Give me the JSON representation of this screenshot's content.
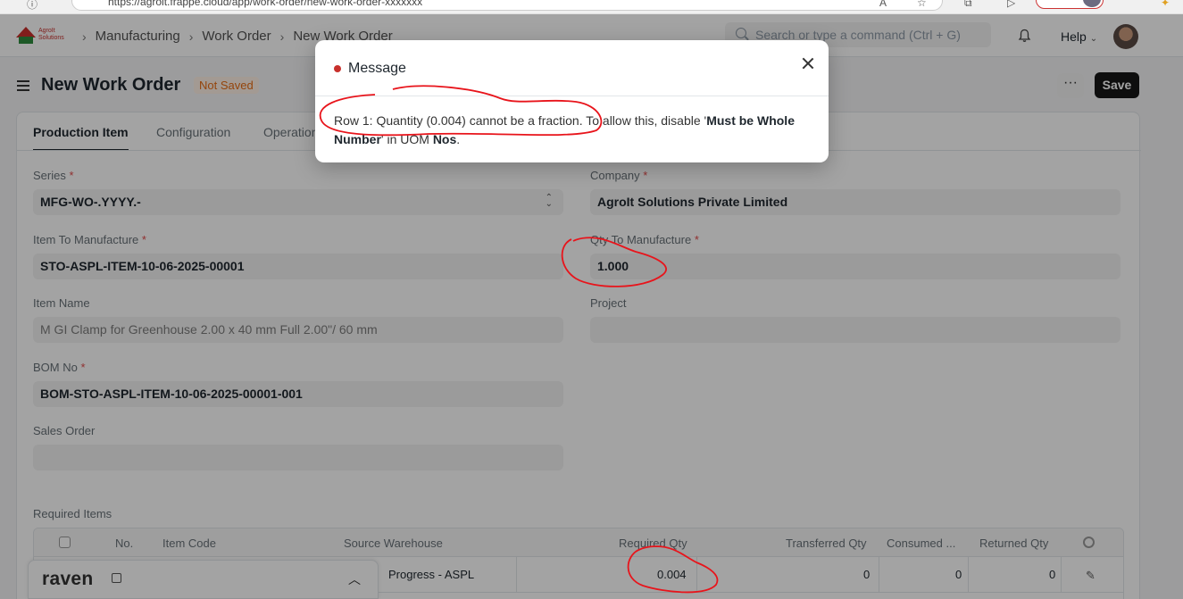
{
  "browser": {
    "url_text": "https://agroit.frappe.cloud/app/work-order/new-work-order-xxxxxxx"
  },
  "navbar": {
    "logo_text_1": "AgroIt",
    "logo_text_2": "Solutions",
    "breadcrumbs": [
      "Manufacturing",
      "Work Order",
      "New Work Order"
    ],
    "search_placeholder": "Search or type a command (Ctrl + G)",
    "help_label": "Help"
  },
  "page": {
    "title": "New Work Order",
    "status": "Not Saved",
    "more_label": "···",
    "save_label": "Save"
  },
  "tabs": [
    {
      "label": "Production Item",
      "active": true
    },
    {
      "label": "Configuration",
      "active": false
    },
    {
      "label": "Operations",
      "active": false
    }
  ],
  "form": {
    "series": {
      "label": "Series",
      "value": "MFG-WO-.YYYY.-"
    },
    "company": {
      "label": "Company",
      "value": "AgroIt Solutions Private Limited"
    },
    "item_to_manufacture": {
      "label": "Item To Manufacture",
      "value": "STO-ASPL-ITEM-10-06-2025-00001"
    },
    "qty_to_manufacture": {
      "label": "Qty To Manufacture",
      "value": "1.000"
    },
    "item_name": {
      "label": "Item Name",
      "value": "M GI Clamp for Greenhouse 2.00 x 40 mm Full 2.00\"/ 60 mm"
    },
    "project": {
      "label": "Project",
      "value": ""
    },
    "bom_no": {
      "label": "BOM No",
      "value": "BOM-STO-ASPL-ITEM-10-06-2025-00001-001"
    },
    "sales_order": {
      "label": "Sales Order",
      "value": ""
    },
    "required_marker": "*"
  },
  "required_items": {
    "title": "Required Items",
    "columns": [
      "No.",
      "Item Code",
      "Source Warehouse",
      "Required Qty",
      "Transferred Qty",
      "Consumed ...",
      "Returned Qty"
    ],
    "rows": [
      {
        "source_warehouse": "Progress - ASPL",
        "required_qty": "0.004",
        "transferred_qty": "0",
        "consumed_qty": "0",
        "returned_qty": "0"
      }
    ]
  },
  "raven": {
    "logo": "raven"
  },
  "modal": {
    "title": "Message",
    "body_part1": "Row 1: Quantity (0.004) cannot be a fraction. To allow this, disable '",
    "body_bold1": "Must be Whole Number",
    "body_part2": "' in UOM ",
    "body_bold2": "Nos",
    "body_part3": "."
  },
  "colors": {
    "accent": "#171717",
    "indicator_bg": "#fff1e7",
    "indicator_text": "#e86c13",
    "annotation": "#e8141b",
    "overlay": "rgba(0,0,0,0.36)"
  }
}
